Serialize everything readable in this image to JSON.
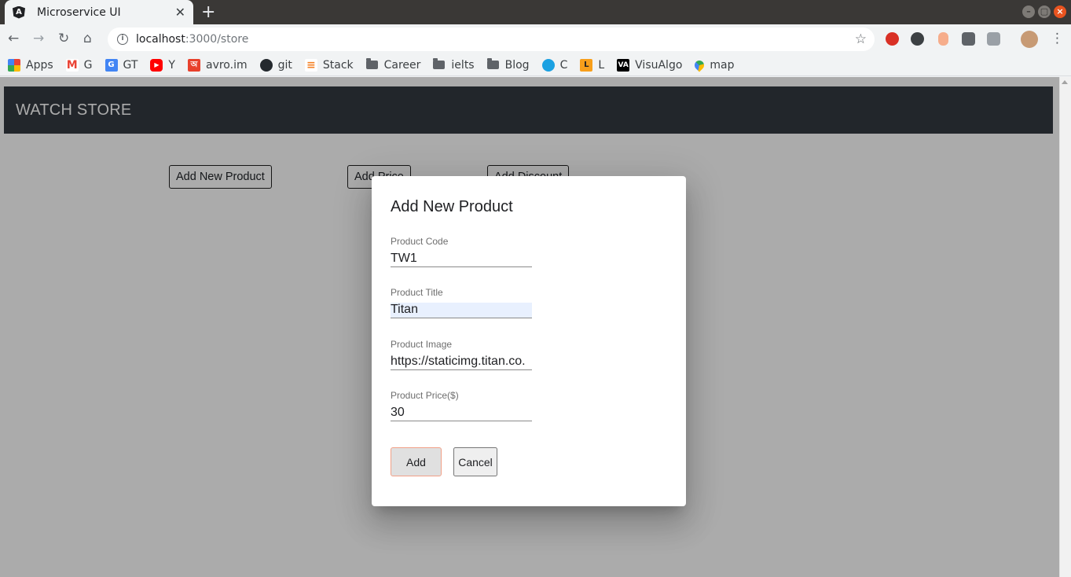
{
  "browser": {
    "tab_title": "Microservice UI",
    "tab_close": "✕",
    "new_tab": "+",
    "url_host": "localhost",
    "url_path": ":3000/store",
    "bookmarks": [
      {
        "label": "Apps",
        "icon": "apps-grid-icon"
      },
      {
        "label": "G",
        "icon": "gmail-icon"
      },
      {
        "label": "GT",
        "icon": "google-translate-icon"
      },
      {
        "label": "Y",
        "icon": "youtube-icon"
      },
      {
        "label": "avro.im",
        "icon": "avro-icon"
      },
      {
        "label": "git",
        "icon": "github-icon"
      },
      {
        "label": "Stack",
        "icon": "stackoverflow-icon"
      },
      {
        "label": "Career",
        "icon": "folder-icon"
      },
      {
        "label": "ielts",
        "icon": "folder-icon"
      },
      {
        "label": "Blog",
        "icon": "folder-icon"
      },
      {
        "label": "C",
        "icon": "globe-icon"
      },
      {
        "label": "L",
        "icon": "leetcode-icon"
      },
      {
        "label": "VisuAlgo",
        "icon": "visualgo-icon"
      },
      {
        "label": "map",
        "icon": "maps-pin-icon"
      }
    ]
  },
  "app": {
    "brand": "WATCH STORE",
    "buttons": {
      "add_product": "Add New Product",
      "add_price": "Add Price",
      "add_discount": "Add Discount"
    }
  },
  "dialog": {
    "title": "Add New Product",
    "fields": [
      {
        "label": "Product Code",
        "value": "TW1"
      },
      {
        "label": "Product Title",
        "value": "Titan"
      },
      {
        "label": "Product Image",
        "value": "https://staticimg.titan.co."
      },
      {
        "label": "Product Price($)",
        "value": "30"
      }
    ],
    "add_label": "Add",
    "cancel_label": "Cancel"
  },
  "colors": {
    "appbar": "#343a40",
    "add_button_border": "#f1a087",
    "autofill": "#e8f0fe"
  }
}
